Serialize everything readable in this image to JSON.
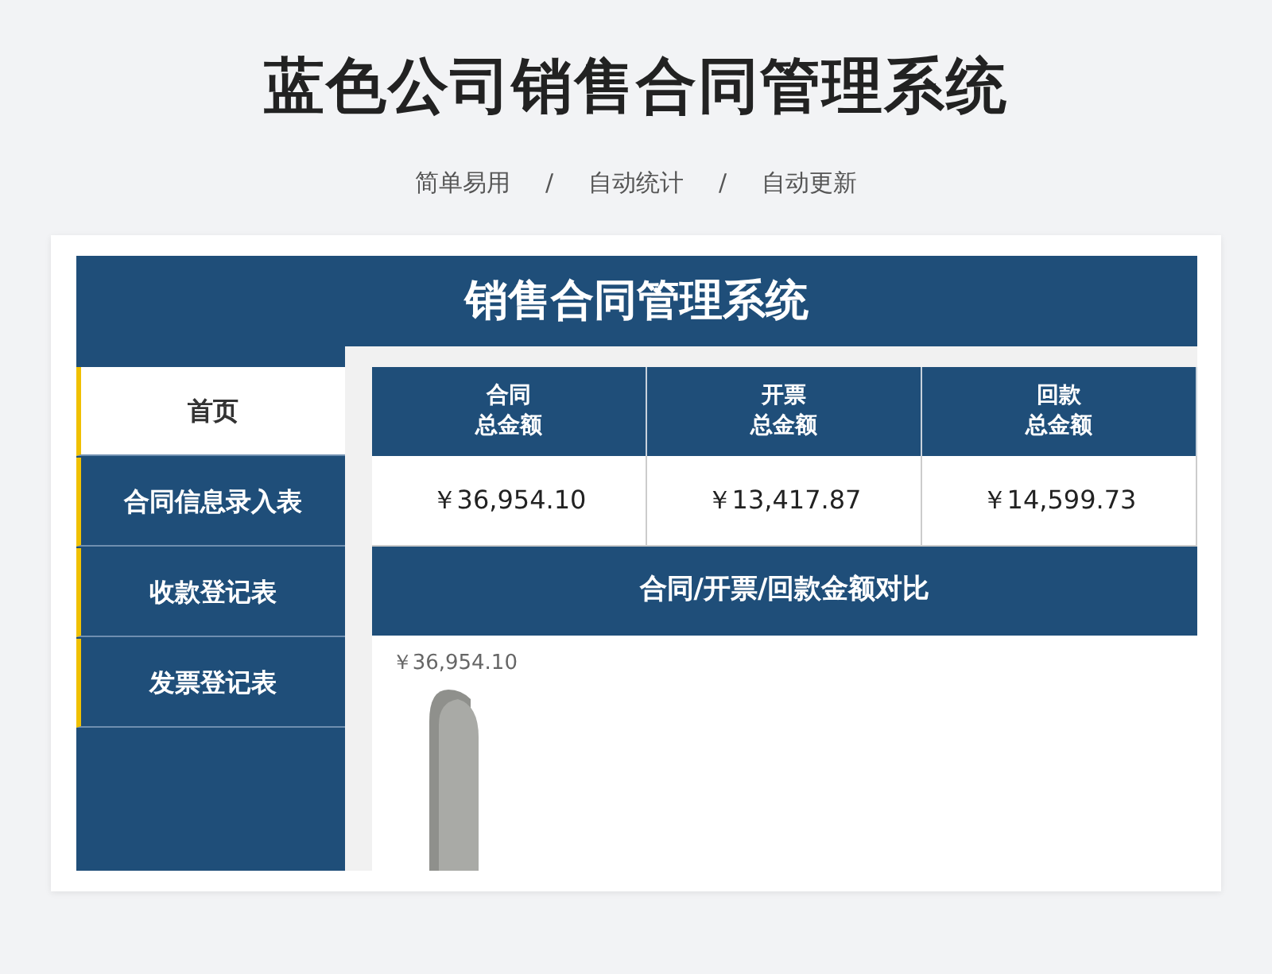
{
  "page_title": "蓝色公司销售合同管理系统",
  "subtitle": {
    "items": [
      "简单易用",
      "自动统计",
      "自动更新"
    ],
    "separators": [
      "/",
      "/"
    ]
  },
  "app": {
    "title": "销售合同管理系统",
    "sidebar": {
      "items": [
        {
          "label": "首页",
          "selected": true
        },
        {
          "label": "合同信息录入表",
          "selected": false
        },
        {
          "label": "收款登记表",
          "selected": false
        },
        {
          "label": "发票登记表",
          "selected": false
        }
      ]
    },
    "stats": [
      {
        "label_lines": [
          "合同",
          "总金额"
        ],
        "value": "￥36,954.10"
      },
      {
        "label_lines": [
          "开票",
          "总金额"
        ],
        "value": "￥13,417.87"
      },
      {
        "label_lines": [
          "回款",
          "总金额"
        ],
        "value": "￥14,599.73"
      }
    ],
    "chart": {
      "title": "合同/开票/回款金额对比",
      "bar_labels": [
        "￥36,954.10"
      ]
    }
  }
}
